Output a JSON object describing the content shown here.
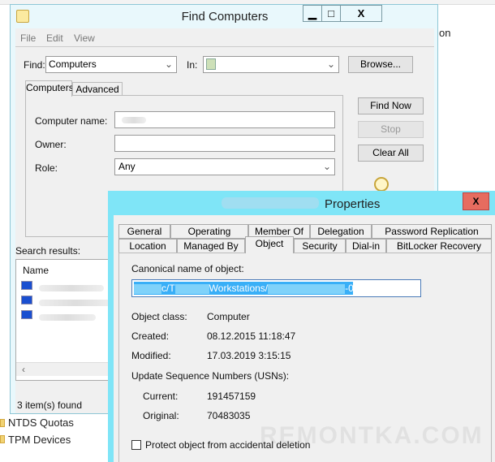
{
  "background": {
    "right_text": "on",
    "bottom_items": [
      "NTDS Quotas",
      "TPM Devices"
    ]
  },
  "find_window": {
    "title": "Find Computers",
    "menu": [
      "File",
      "Edit",
      "View"
    ],
    "find_label": "Find:",
    "find_value": "Computers",
    "in_label": "In:",
    "in_value": "",
    "browse": "Browse...",
    "tabs": [
      "Computers",
      "Advanced"
    ],
    "fields": [
      {
        "label": "Computer name:",
        "value": ""
      },
      {
        "label": "Owner:",
        "value": ""
      },
      {
        "label": "Role:",
        "value": "Any"
      }
    ],
    "buttons": {
      "find_now": "Find Now",
      "stop": "Stop",
      "clear_all": "Clear All"
    },
    "results_label": "Search results:",
    "column_name": "Name",
    "status": "3 item(s) found"
  },
  "properties": {
    "title": "Properties",
    "close": "X",
    "tabs_row1": [
      "General",
      "Operating System",
      "Member Of",
      "Delegation",
      "Password Replication"
    ],
    "tabs_row2": [
      "Location",
      "Managed By",
      "Object",
      "Security",
      "Dial-in",
      "BitLocker Recovery"
    ],
    "active_tab": "Object",
    "canonical_label": "Canonical name of object:",
    "canonical_parts": [
      "c/T",
      "Workstations/",
      "-01"
    ],
    "rows": [
      {
        "label": "Object class:",
        "value": "Computer"
      },
      {
        "label": "Created:",
        "value": "08.12.2015 11:18:47"
      },
      {
        "label": "Modified:",
        "value": "17.03.2019 3:15:15"
      }
    ],
    "usn_label": "Update Sequence Numbers (USNs):",
    "usn": [
      {
        "label": "Current:",
        "value": "191457159"
      },
      {
        "label": "Original:",
        "value": "70483035"
      }
    ],
    "protect_label": "Protect object from accidental deletion",
    "protect_checked": false
  },
  "watermark": "REMONTKA.COM"
}
